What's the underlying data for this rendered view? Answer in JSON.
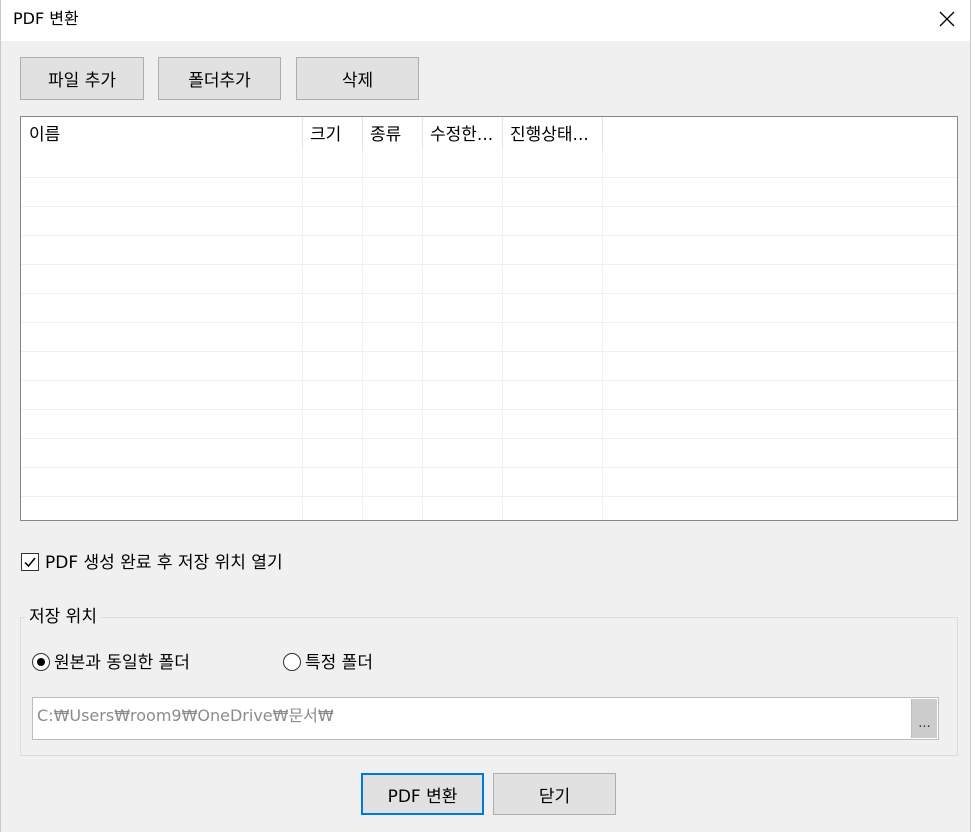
{
  "window": {
    "title": "PDF 변환",
    "close_icon": "close-icon"
  },
  "toolbar": {
    "add_file_label": "파일 추가",
    "add_folder_label": "폴더추가",
    "delete_label": "삭제"
  },
  "file_list": {
    "columns": [
      "이름",
      "크기",
      "종류",
      "수정한...",
      "진행상태..."
    ],
    "rows": []
  },
  "options": {
    "open_location_label": "PDF 생성 완료 후 저장 위치 열기",
    "open_location_checked": true
  },
  "save_location": {
    "group_title": "저장 위치",
    "same_folder_label": "원본과 동일한 폴더",
    "same_folder_selected": true,
    "specific_folder_label": "특정 폴더",
    "specific_folder_selected": false,
    "path_value": "C:₩Users₩room9₩OneDrive₩문서₩",
    "browse_label": "..."
  },
  "footer": {
    "convert_label": "PDF 변환",
    "close_label": "닫기"
  }
}
